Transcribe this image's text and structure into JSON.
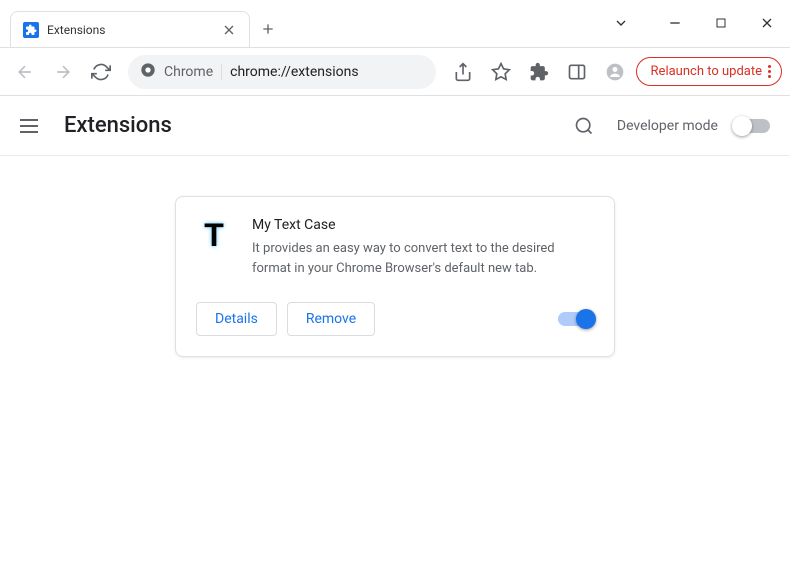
{
  "tab": {
    "title": "Extensions"
  },
  "omnibox": {
    "prefix_icon": "chrome",
    "prefix_text": "Chrome",
    "url": "chrome://extensions"
  },
  "relaunch": {
    "label": "Relaunch to update"
  },
  "page": {
    "title": "Extensions",
    "dev_mode_label": "Developer mode",
    "dev_mode_on": false
  },
  "extension": {
    "name": "My Text Case",
    "description": "It provides an easy way to convert text to the desired format in your Chrome Browser's default new tab.",
    "icon_letter": "T",
    "enabled": true,
    "details_label": "Details",
    "remove_label": "Remove"
  }
}
